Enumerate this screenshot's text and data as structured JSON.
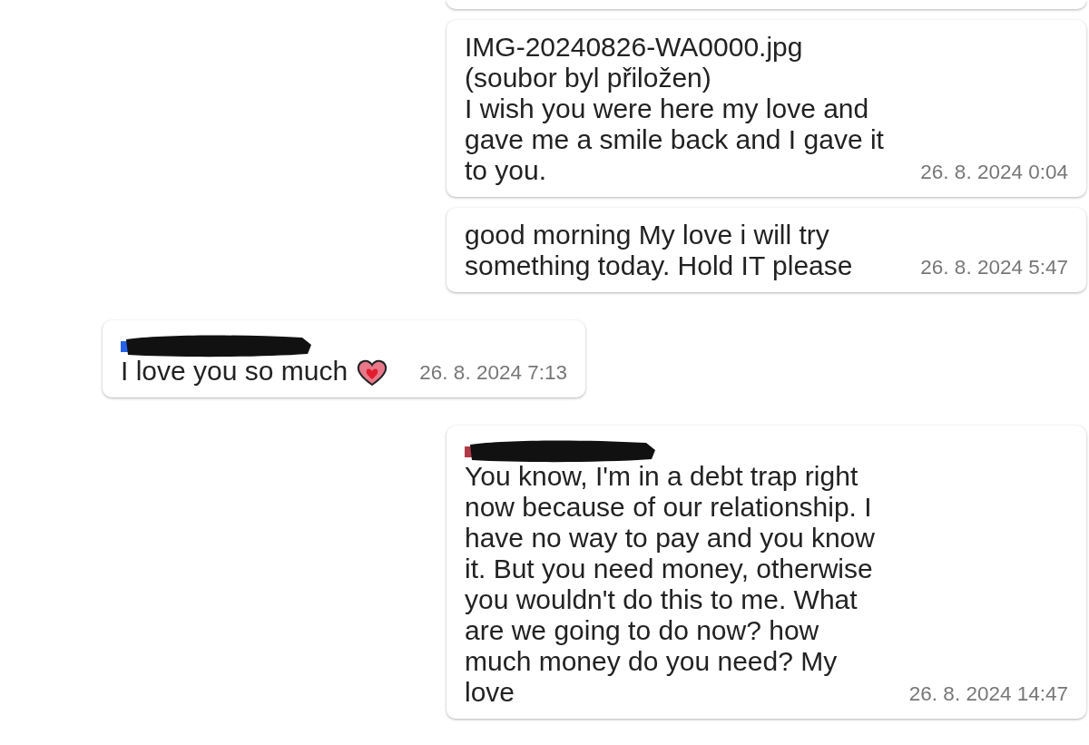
{
  "messages": [
    {
      "kind": "outgoing",
      "lines": [
        "IMG-20240826-WA0000.jpg",
        "(soubor byl přiložen)",
        "I wish you were here my love and gave me a smile back and I gave it to you."
      ],
      "time": "26. 8. 2024 0:04"
    },
    {
      "kind": "outgoing",
      "lines": [
        "good morning My love i will try something today. Hold IT please"
      ],
      "time": "26. 8. 2024 5:47"
    },
    {
      "kind": "incoming",
      "sender": {
        "redacted": true,
        "color": "#2563eb"
      },
      "lines": [
        "I love you so much"
      ],
      "heart": true,
      "time": "26. 8. 2024 7:13"
    },
    {
      "kind": "outgoing",
      "sender": {
        "redacted": true,
        "color": "#b23a48"
      },
      "lines": [
        "You know, I'm in a debt trap right now because of our relationship.  I have no way to pay and you know it.  But you need money, otherwise you wouldn't do this to me.  What are we going to do now?  how much money do you need? My love"
      ],
      "time": "26. 8. 2024 14:47"
    }
  ]
}
